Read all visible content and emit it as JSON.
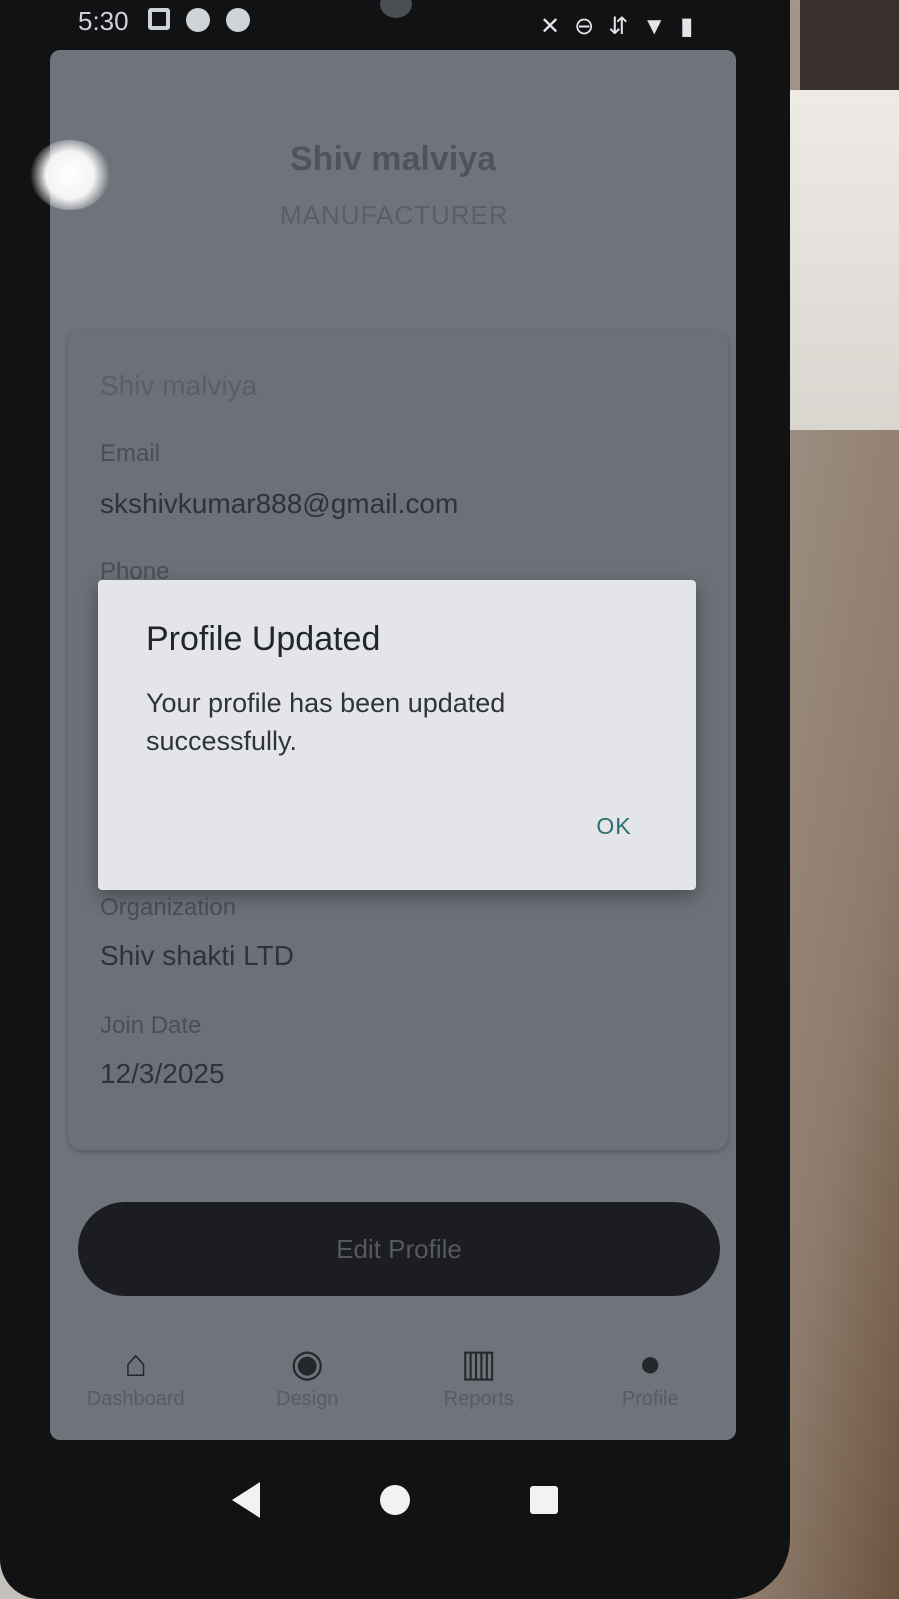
{
  "status_bar": {
    "time": "5:30"
  },
  "profile": {
    "name": "Shiv malviya",
    "role": "MANUFACTURER",
    "fields": {
      "name_value": "Shiv malviya",
      "email_label": "Email",
      "email_value": "skshivkumar888@gmail.com",
      "phone_label": "Phone",
      "organization_label": "Organization",
      "organization_value": "Shiv shakti LTD",
      "join_date_label": "Join Date",
      "join_date_value": "12/3/2025"
    },
    "edit_button": "Edit Profile"
  },
  "bottom_nav": {
    "items": [
      {
        "label": "Dashboard",
        "icon": "home-icon"
      },
      {
        "label": "Design",
        "icon": "palette-icon"
      },
      {
        "label": "Reports",
        "icon": "bar-chart-icon"
      },
      {
        "label": "Profile",
        "icon": "person-icon"
      }
    ]
  },
  "dialog": {
    "title": "Profile Updated",
    "message": "Your profile has been updated successfully.",
    "ok_label": "OK"
  },
  "colors": {
    "dialog_bg": "#e3e5e8",
    "ok_accent": "#2c6f73",
    "button_dark": "#1c1d20"
  }
}
